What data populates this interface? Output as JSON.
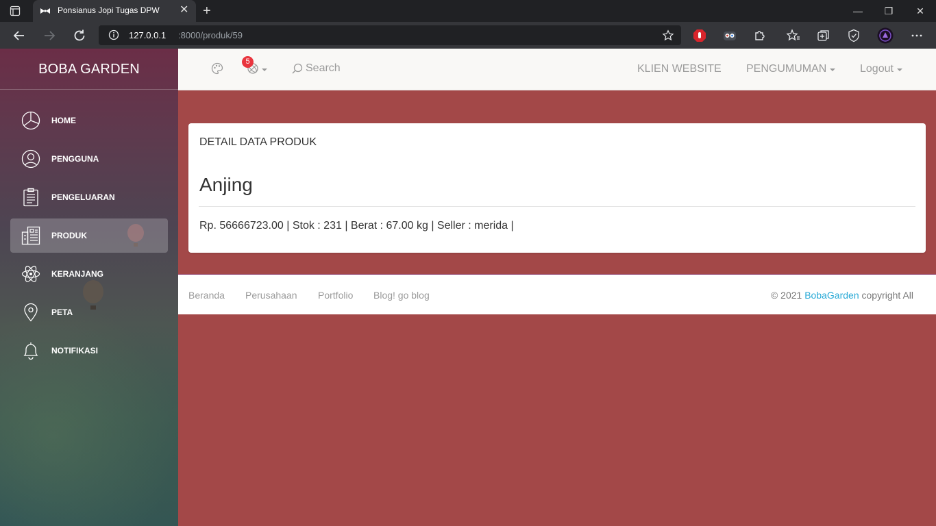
{
  "browser": {
    "tab_title": "Ponsianus Jopi Tugas DPW",
    "url_host": "127.0.0.1",
    "url_path": ":8000/produk/59",
    "new_tab": "+",
    "minimize": "—",
    "maximize": "❐",
    "close": "✕"
  },
  "sidebar": {
    "brand": "BOBA GARDEN",
    "items": [
      {
        "label": "HOME",
        "icon": "pie-chart-icon"
      },
      {
        "label": "PENGGUNA",
        "icon": "user-icon"
      },
      {
        "label": "PENGELUARAN",
        "icon": "clipboard-icon"
      },
      {
        "label": "PRODUK",
        "icon": "building-icon",
        "active": true
      },
      {
        "label": "KERANJANG",
        "icon": "atom-icon"
      },
      {
        "label": "PETA",
        "icon": "map-pin-icon"
      },
      {
        "label": "NOTIFIKASI",
        "icon": "bell-icon"
      }
    ]
  },
  "topnav": {
    "notification_count": "5",
    "search_label": "Search",
    "links": [
      "KLIEN WEBSITE",
      "PENGUMUMAN",
      "Logout"
    ]
  },
  "card": {
    "header": "DETAIL DATA PRODUK",
    "product_name": "Anjing",
    "details": "Rp. 56666723.00 | Stok : 231 | Berat : 67.00 kg | Seller : merida |"
  },
  "footer": {
    "links": [
      "Beranda",
      "Perusahaan",
      "Portfolio",
      "Blog! go blog"
    ],
    "copyright_prefix": "© 2021 ",
    "copyright_brand": "BobaGarden",
    "copyright_suffix": " copyright All"
  },
  "colors": {
    "content_bg": "#a34848",
    "sidebar_top": "#6b2e47",
    "badge": "#e9353e",
    "link_accent": "#27a9d6"
  }
}
